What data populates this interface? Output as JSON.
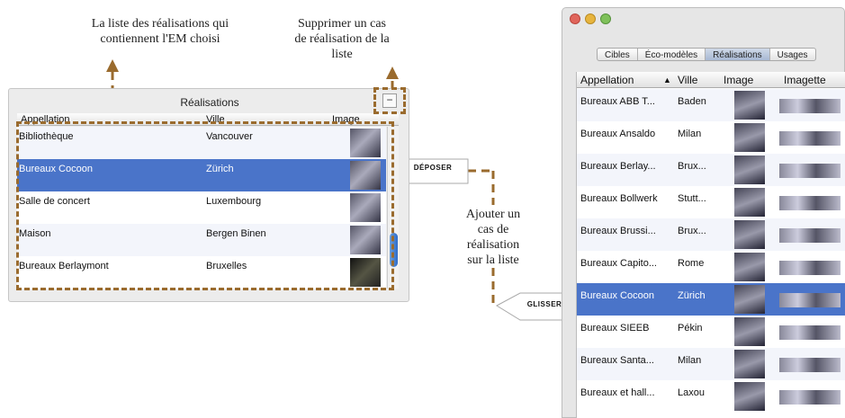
{
  "annotations": {
    "list_caption": "La liste des réalisations qui\ncontiennent l'EM choisi",
    "delete_caption": "Supprimer un cas\nde réalisation de la\nliste",
    "add_caption": "Ajouter un\ncas de\nréalisation\nsur la  liste",
    "drop_tag": "DÉPOSER",
    "drag_tag": "GLISSER"
  },
  "left_panel": {
    "title": "Réalisations",
    "remove_button": "−",
    "columns": [
      "Appellation",
      "Ville",
      "Image"
    ],
    "rows": [
      {
        "name": "Bibliothèque",
        "city": "Vancouver"
      },
      {
        "name": "Bureaux Cocoon",
        "city": "Zürich",
        "selected": true
      },
      {
        "name": "Salle de concert",
        "city": "Luxembourg"
      },
      {
        "name": "Maison",
        "city": "Bergen Binen"
      },
      {
        "name": "Bureaux Berlaymont",
        "city": "Bruxelles"
      }
    ]
  },
  "right_window": {
    "tabs": [
      "Cibles",
      "Éco-modèles",
      "Réalisations",
      "Usages"
    ],
    "selected_tab": "Réalisations",
    "columns": [
      "Appellation",
      "Ville",
      "Image",
      "Imagette"
    ],
    "sort_indicator": "▲",
    "rows": [
      {
        "name": "Bureaux ABB T...",
        "city": "Baden"
      },
      {
        "name": "Bureaux Ansaldo",
        "city": "Milan"
      },
      {
        "name": "Bureaux Berlay...",
        "city": "Brux..."
      },
      {
        "name": "Bureaux Bollwerk",
        "city": "Stutt..."
      },
      {
        "name": "Bureaux Brussi...",
        "city": "Brux..."
      },
      {
        "name": "Bureaux Capito...",
        "city": "Rome"
      },
      {
        "name": "Bureaux Cocoon",
        "city": "Zürich",
        "selected": true
      },
      {
        "name": "Bureaux SIEEB",
        "city": "Pékin"
      },
      {
        "name": "Bureaux Santa...",
        "city": "Milan"
      },
      {
        "name": "Bureaux et hall...",
        "city": "Laxou"
      }
    ]
  },
  "colors": {
    "selection": "#4a74c9",
    "annotation_dash": "#9a6b2e"
  }
}
